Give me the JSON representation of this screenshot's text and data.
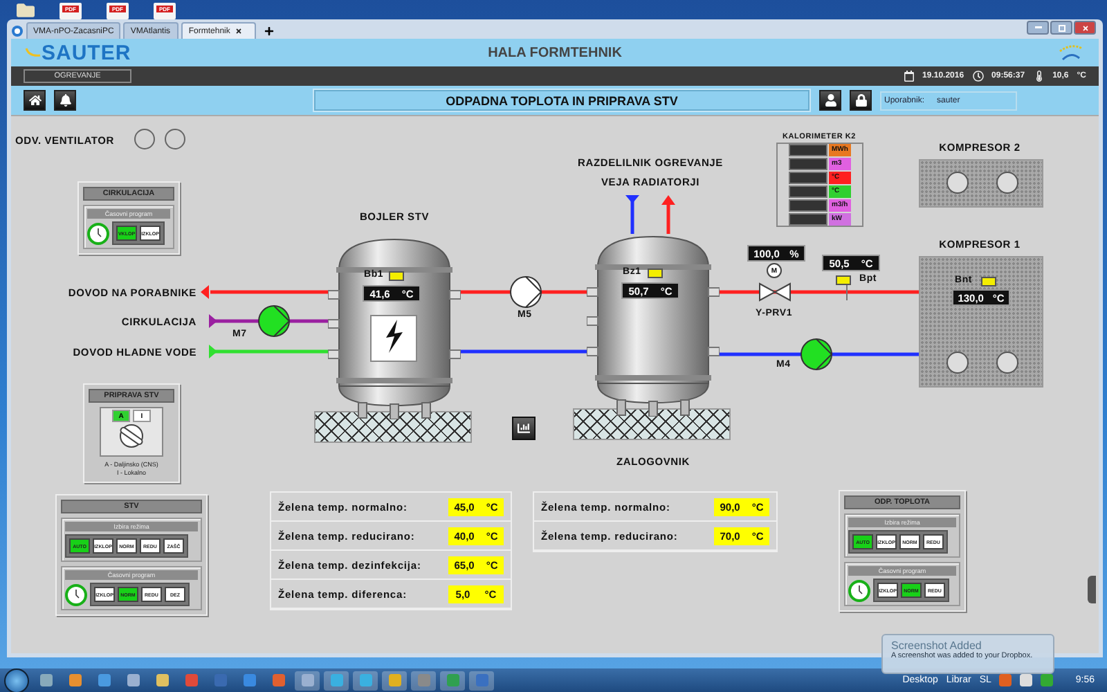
{
  "desktop_icons": [
    {
      "kind": "folder"
    },
    {
      "kind": "pdf",
      "label": "PDF"
    },
    {
      "kind": "pdf",
      "label": "PDF"
    },
    {
      "kind": "pdf",
      "label": "PDF"
    }
  ],
  "browser_tabs": [
    {
      "label": "VMA-nPO-ZacasniPC",
      "selected": false
    },
    {
      "label": "VMAtlantis",
      "selected": false
    },
    {
      "label": "Formtehnik",
      "selected": true
    }
  ],
  "header": {
    "logo": "SAUTER",
    "title": "HALA FORMTEHNIK"
  },
  "menu_items": [
    "OGREVANJE"
  ],
  "status": {
    "date": "19.10.2016",
    "time": "09:56:37",
    "temperature": "10,6",
    "temperature_unit": "°C"
  },
  "page_title": "ODPADNA TOPLOTA IN PRIPRAVA STV",
  "user": {
    "label": "Uporabnik:",
    "value": "sauter"
  },
  "ventilator": {
    "label": "ODV. VENTILATOR",
    "lamps": [
      {
        "on": false
      },
      {
        "on": false
      }
    ]
  },
  "cirkulacija_panel": {
    "title": "CIRKULACIJA",
    "group": "Časovni program",
    "buttons": [
      {
        "label": "VKLOP",
        "selected": true
      },
      {
        "label": "IZKLOP",
        "selected": false
      }
    ]
  },
  "pipe_labels": [
    "DOVOD NA PORABNIKE",
    "CIRKULACIJA",
    "DOVOD HLADNE VODE"
  ],
  "pumps": [
    {
      "label": "M7",
      "on": true
    },
    {
      "label": "M5",
      "on": false
    },
    {
      "label": "M4",
      "on": true
    }
  ],
  "tanks": [
    {
      "title": "BOJLER STV",
      "sensor": "Bb1",
      "value": "41,6",
      "unit": "°C",
      "heater": true
    },
    {
      "title": "ZALOGOVNIK",
      "sensor": "Bz1",
      "value": "50,7",
      "unit": "°C",
      "heater": false
    }
  ],
  "distributor": [
    "RAZDELILNIK OGREVANJE",
    "VEJA RADIATORJI"
  ],
  "calorimeter": {
    "title": "KALORIMETER K2",
    "rows": [
      {
        "unit": "MWh",
        "color": "#e87820"
      },
      {
        "unit": "m3",
        "color": "#e060e0"
      },
      {
        "unit": "°C",
        "color": "#ff2020"
      },
      {
        "unit": "°C",
        "color": "#30d030"
      },
      {
        "unit": "m3/h",
        "color": "#e060e0"
      },
      {
        "unit": "kW",
        "color": "#d070e0"
      }
    ]
  },
  "valve": {
    "label": "Y-PRV1",
    "actuator": "M",
    "value": "100,0",
    "unit": "%"
  },
  "pipe_sensor": {
    "label": "Bpt",
    "value": "50,5",
    "unit": "°C"
  },
  "compressors": [
    {
      "title": "KOMPRESOR 2"
    },
    {
      "title": "KOMPRESOR 1",
      "sensor": "Bnt",
      "value": "130,0",
      "unit": "°C"
    }
  ],
  "priprava_panel": {
    "title": "PRIPRAVA STV",
    "positions": [
      {
        "label": "A",
        "selected": true
      },
      {
        "label": "I",
        "selected": false
      }
    ],
    "legend": [
      "A - Daljinsko (CNS)",
      "I - Lokalno"
    ]
  },
  "mode_panels": [
    {
      "title": "STV",
      "groups": [
        {
          "title": "Izbira režima",
          "clock": false,
          "buttons": [
            {
              "label": "AUTO",
              "selected": true
            },
            {
              "label": "IZKLOP",
              "selected": false
            },
            {
              "label": "NORM",
              "selected": false
            },
            {
              "label": "REDU",
              "selected": false
            },
            {
              "label": "ZAŠČ",
              "selected": false
            }
          ]
        },
        {
          "title": "Časovni program",
          "clock": true,
          "buttons": [
            {
              "label": "IZKLOP",
              "selected": false
            },
            {
              "label": "NORM",
              "selected": true
            },
            {
              "label": "REDU",
              "selected": false
            },
            {
              "label": "DEZ",
              "selected": false
            }
          ]
        }
      ]
    },
    {
      "title": "ODP. TOPLOTA",
      "groups": [
        {
          "title": "Izbira režima",
          "clock": false,
          "buttons": [
            {
              "label": "AUTO",
              "selected": true
            },
            {
              "label": "IZKLOP",
              "selected": false
            },
            {
              "label": "NORM",
              "selected": false
            },
            {
              "label": "REDU",
              "selected": false
            }
          ]
        },
        {
          "title": "Časovni program",
          "clock": true,
          "buttons": [
            {
              "label": "IZKLOP",
              "selected": false
            },
            {
              "label": "NORM",
              "selected": true
            },
            {
              "label": "REDU",
              "selected": false
            }
          ]
        }
      ]
    }
  ],
  "setpoint_lists": [
    [
      {
        "label": "Želena temp. normalno:",
        "value": "45,0",
        "unit": "°C"
      },
      {
        "label": "Želena temp. reducirano:",
        "value": "40,0",
        "unit": "°C"
      },
      {
        "label": "Želena temp. dezinfekcija:",
        "value": "65,0",
        "unit": "°C"
      },
      {
        "label": "Želena temp. diferenca:",
        "value": "5,0",
        "unit": "°C"
      }
    ],
    [
      {
        "label": "Želena temp. normalno:",
        "value": "90,0",
        "unit": "°C"
      },
      {
        "label": "Želena temp. reducirano:",
        "value": "70,0",
        "unit": "°C"
      }
    ]
  ],
  "notification": {
    "title": "Screenshot Added",
    "text": "A screenshot was added to your Dropbox."
  },
  "taskbar": {
    "items": [
      "Desktop",
      "Librar"
    ],
    "language": "SL",
    "clock": "9:56"
  }
}
